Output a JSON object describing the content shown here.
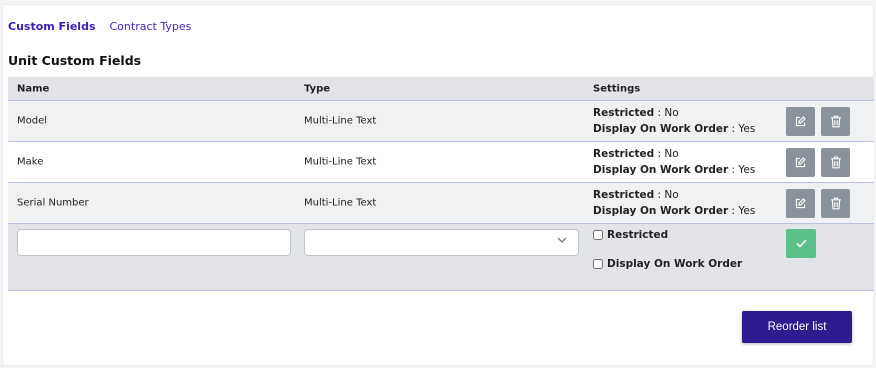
{
  "tabs": [
    {
      "label": "Custom Fields",
      "active": true
    },
    {
      "label": "Contract Types",
      "active": false
    }
  ],
  "section_title": "Unit Custom Fields",
  "columns": {
    "name": "Name",
    "type": "Type",
    "settings": "Settings"
  },
  "settings_labels": {
    "restricted": "Restricted",
    "display": "Display On Work Order"
  },
  "rows": [
    {
      "name": "Model",
      "type": "Multi-Line Text",
      "restricted": ": No",
      "display": ": Yes"
    },
    {
      "name": "Make",
      "type": "Multi-Line Text",
      "restricted": ": No",
      "display": ": Yes"
    },
    {
      "name": "Serial Number",
      "type": "Multi-Line Text",
      "restricted": ": No",
      "display": ": Yes"
    }
  ],
  "new_row": {
    "name_value": "",
    "type_value": "",
    "restricted_checked": false,
    "display_checked": false,
    "restricted_label": "Restricted",
    "display_label": "Display On Work Order"
  },
  "icons": {
    "edit": "pencil-square-icon",
    "delete": "trash-icon",
    "confirm": "check-icon",
    "dropdown": "chevron-down-icon"
  },
  "colors": {
    "accent": "#2e1b8f",
    "link": "#4a23c9",
    "icon_button": "#8a939c",
    "confirm": "#5cc08a"
  },
  "reorder_label": "Reorder list"
}
